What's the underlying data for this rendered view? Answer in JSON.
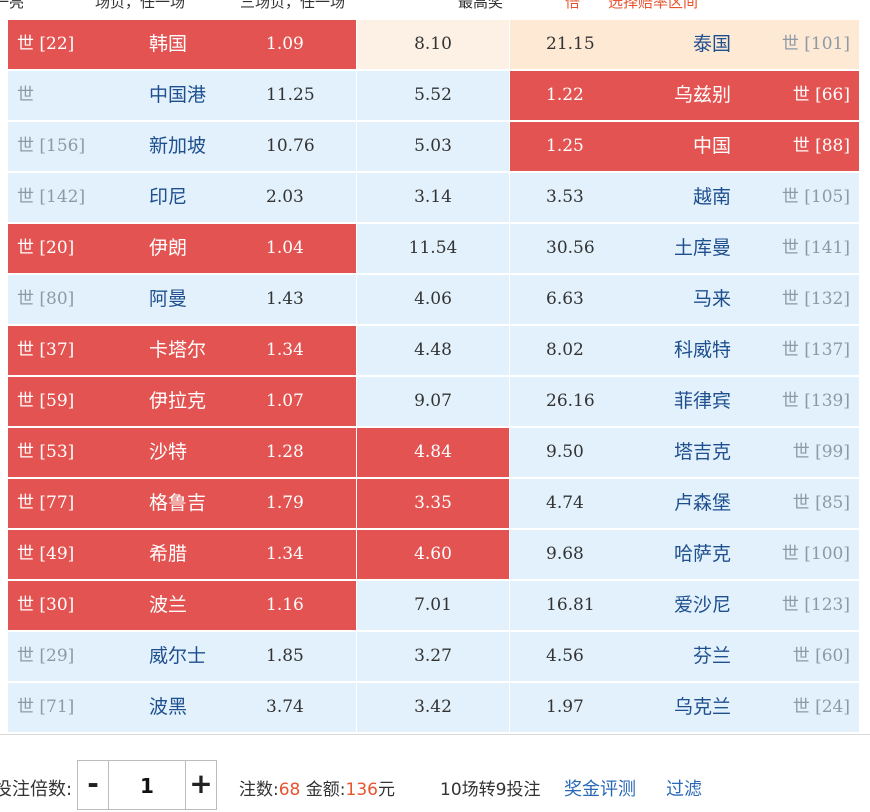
{
  "top_strip": {
    "fragment_1": "一亮",
    "fragment_2": "场负，任一场",
    "fragment_3": "三场负，任一场",
    "fragment_4": "最高奖",
    "fragment_5": "倍 ",
    "fragment_6": "选择赔率区间"
  },
  "rank_prefix": "世",
  "rows": [
    {
      "home_rank": "[22]",
      "home_team": "韩国",
      "home_odds": "1.09",
      "draw_odds": "8.10",
      "away_odds": "21.15",
      "away_team": "泰国",
      "away_rank": "[101]",
      "home_sel": true,
      "draw_sel": "peach",
      "away_sel": "peach2"
    },
    {
      "home_rank": "",
      "home_team": "中国港",
      "home_odds": "11.25",
      "draw_odds": "5.52",
      "away_odds": "1.22",
      "away_team": "乌兹别",
      "away_rank": "[66]",
      "home_sel": false,
      "draw_sel": false,
      "away_sel": true
    },
    {
      "home_rank": "[156]",
      "home_team": "新加坡",
      "home_odds": "10.76",
      "draw_odds": "5.03",
      "away_odds": "1.25",
      "away_team": "中国",
      "away_rank": "[88]",
      "home_sel": false,
      "draw_sel": false,
      "away_sel": true
    },
    {
      "home_rank": "[142]",
      "home_team": "印尼",
      "home_odds": "2.03",
      "draw_odds": "3.14",
      "away_odds": "3.53",
      "away_team": "越南",
      "away_rank": "[105]",
      "home_sel": false,
      "draw_sel": false,
      "away_sel": false
    },
    {
      "home_rank": "[20]",
      "home_team": "伊朗",
      "home_odds": "1.04",
      "draw_odds": "11.54",
      "away_odds": "30.56",
      "away_team": "土库曼",
      "away_rank": "[141]",
      "home_sel": true,
      "draw_sel": false,
      "away_sel": false
    },
    {
      "home_rank": "[80]",
      "home_team": "阿曼",
      "home_odds": "1.43",
      "draw_odds": "4.06",
      "away_odds": "6.63",
      "away_team": "马来",
      "away_rank": "[132]",
      "home_sel": false,
      "draw_sel": false,
      "away_sel": false
    },
    {
      "home_rank": "[37]",
      "home_team": "卡塔尔",
      "home_odds": "1.34",
      "draw_odds": "4.48",
      "away_odds": "8.02",
      "away_team": "科威特",
      "away_rank": "[137]",
      "home_sel": true,
      "draw_sel": false,
      "away_sel": false
    },
    {
      "home_rank": "[59]",
      "home_team": "伊拉克",
      "home_odds": "1.07",
      "draw_odds": "9.07",
      "away_odds": "26.16",
      "away_team": "菲律宾",
      "away_rank": "[139]",
      "home_sel": true,
      "draw_sel": false,
      "away_sel": false
    },
    {
      "home_rank": "[53]",
      "home_team": "沙特",
      "home_odds": "1.28",
      "draw_odds": "4.84",
      "away_odds": "9.50",
      "away_team": "塔吉克",
      "away_rank": "[99]",
      "home_sel": true,
      "draw_sel": true,
      "away_sel": false
    },
    {
      "home_rank": "[77]",
      "home_team": "格鲁吉",
      "home_odds": "1.79",
      "draw_odds": "3.35",
      "away_odds": "4.74",
      "away_team": "卢森堡",
      "away_rank": "[85]",
      "home_sel": true,
      "draw_sel": true,
      "away_sel": false
    },
    {
      "home_rank": "[49]",
      "home_team": "希腊",
      "home_odds": "1.34",
      "draw_odds": "4.60",
      "away_odds": "9.68",
      "away_team": "哈萨克",
      "away_rank": "[100]",
      "home_sel": true,
      "draw_sel": true,
      "away_sel": false
    },
    {
      "home_rank": "[30]",
      "home_team": "波兰",
      "home_odds": "1.16",
      "draw_odds": "7.01",
      "away_odds": "16.81",
      "away_team": "爱沙尼",
      "away_rank": "[123]",
      "home_sel": true,
      "draw_sel": false,
      "away_sel": false
    },
    {
      "home_rank": "[29]",
      "home_team": "威尔士",
      "home_odds": "1.85",
      "draw_odds": "3.27",
      "away_odds": "4.56",
      "away_team": "芬兰",
      "away_rank": "[60]",
      "home_sel": false,
      "draw_sel": false,
      "away_sel": false
    },
    {
      "home_rank": "[71]",
      "home_team": "波黑",
      "home_odds": "3.74",
      "draw_odds": "3.42",
      "away_odds": "1.97",
      "away_team": "乌克兰",
      "away_rank": "[24]",
      "home_sel": false,
      "draw_sel": false,
      "away_sel": false
    }
  ],
  "footer": {
    "multiplier_label": "投注倍数:",
    "minus": "-",
    "plus": "+",
    "multiplier_value": "1",
    "bets_label": "注数:",
    "bets_count": "68",
    "amount_label": " 金额:",
    "amount_value": "136",
    "amount_unit": "元",
    "mode": "10场转9投注",
    "prize_eval": "奖金评测",
    "filter": "过滤"
  },
  "colors": {
    "selected": "#e35351",
    "unselected": "#e2f1fb",
    "link": "#2a68b8",
    "accent": "#e8542e"
  }
}
